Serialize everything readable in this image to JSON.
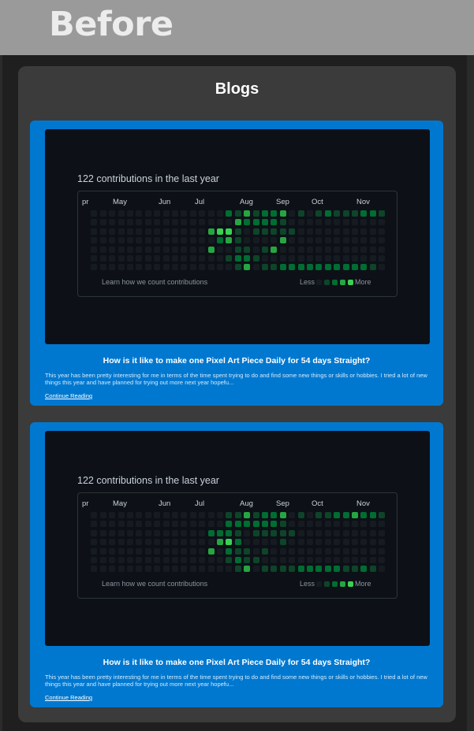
{
  "banner": {
    "label": "Before"
  },
  "section": {
    "title": "Blogs"
  },
  "colors": {
    "card": "#0078d0",
    "panel": "#3b3b3b",
    "screenshot_bg": "#0d1117",
    "levels": [
      "#161b22",
      "#0e4429",
      "#006d32",
      "#26a641",
      "#39d353"
    ]
  },
  "cards": [
    {
      "graph": {
        "heading": "122 contributions in the last year",
        "months": [
          "pr",
          "May",
          "Jun",
          "Jul",
          "Aug",
          "Sep",
          "Oct",
          "Nov"
        ],
        "learn": "Learn how we count contributions",
        "less": "Less",
        "more": "More"
      },
      "title": "How is it like to make one Pixel Art Piece Daily for 54 days Straight?",
      "excerpt": "This year has been pretty interesting for me in terms of the time spent trying to do and find some new things or skills or hobbies. I tried a lot of new things this year and have planned for trying out more next year hopefu...",
      "link": "Continue Reading"
    },
    {
      "graph": {
        "heading": "122 contributions in the last year",
        "months": [
          "pr",
          "May",
          "Jun",
          "Jul",
          "Aug",
          "Sep",
          "Oct",
          "Nov"
        ],
        "learn": "Learn how we count contributions",
        "less": "Less",
        "more": "More"
      },
      "title": "How is it like to make one Pixel Art Piece Daily for 54 days Straight?",
      "excerpt": "This year has been pretty interesting for me in terms of the time spent trying to do and find some new things or skills or hobbies. I tried a lot of new things this year and have planned for trying out more next year hopefu...",
      "link": "Continue Reading"
    }
  ]
}
